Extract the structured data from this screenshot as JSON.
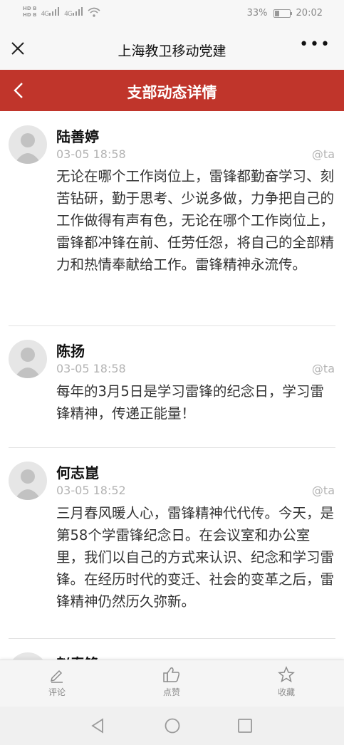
{
  "status_bar": {
    "hd_labels": [
      "HD B",
      "HD B"
    ],
    "net_labels": [
      "4G",
      "4G"
    ],
    "battery": "33%",
    "battery_level": 0.33,
    "time": "20:02"
  },
  "wechat_bar": {
    "title": "上海教卫移动党建",
    "more": "•••",
    "icons": [
      "close-icon",
      "more-icon"
    ]
  },
  "header": {
    "title": "支部动态详情",
    "color": "#c0352b",
    "icons": [
      "back-arrow-icon"
    ]
  },
  "comments": [
    {
      "name": "陆善婷",
      "time": "03-05 18:58",
      "at": "@ta",
      "text": "无论在哪个工作岗位上，雷锋都勤奋学习、刻苦钻研，勤于思考、少说多做，力争把自己的工作做得有声有色，无论在哪个工作岗位上，雷锋都冲锋在前、任劳任怨，将自己的全部精力和热情奉献给工作。雷锋精神永流传。"
    },
    {
      "name": "陈扬",
      "time": "03-05 18:58",
      "at": "@ta",
      "text": "每年的3月5日是学习雷锋的纪念日，学习雷锋精神，传递正能量！"
    },
    {
      "name": "何志崑",
      "time": "03-05 18:52",
      "at": "@ta",
      "text": "三月春风暖人心，雷锋精神代代传。今天，是第58个学雷锋纪念日。在会议室和办公室里，我们以自己的方式来认识、纪念和学习雷锋。在经历时代的变迁、社会的变革之后，雷锋精神仍然历久弥新。"
    },
    {
      "name": "赵春锋",
      "time": "",
      "at": "",
      "text": ""
    }
  ],
  "bottom_bar": {
    "comment": "评论",
    "like": "点赞",
    "favorite": "收藏",
    "icons": [
      "pencil-icon",
      "thumbs-up-icon",
      "star-icon"
    ]
  },
  "nav_bar": {
    "icons": [
      "nav-back-icon",
      "nav-home-icon",
      "nav-recent-icon"
    ]
  }
}
